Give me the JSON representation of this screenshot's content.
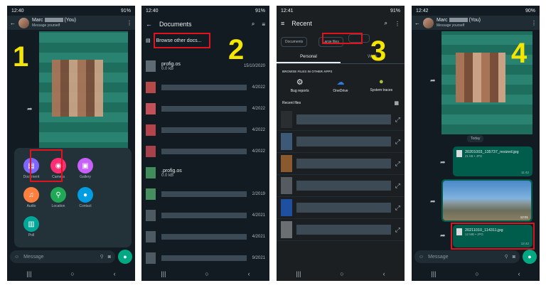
{
  "panel_numbers": [
    "1",
    "2",
    "3",
    "4"
  ],
  "phone1": {
    "time": "12:40",
    "battery": "91%",
    "contact": "Marc",
    "contact_suffix": "(You)",
    "subtitle": "Message yourself",
    "attach": [
      {
        "label": "Document",
        "color": "#7f66ff"
      },
      {
        "label": "Camera",
        "color": "#ff2e74"
      },
      {
        "label": "Gallery",
        "color": "#c861fa"
      },
      {
        "label": "Audio",
        "color": "#ff7f3e"
      },
      {
        "label": "Location",
        "color": "#1fa855"
      },
      {
        "label": "Contact",
        "color": "#009de2"
      },
      {
        "label": "Poll",
        "color": "#02a698"
      }
    ],
    "message_placeholder": "Message"
  },
  "phone2": {
    "time": "12:40",
    "battery": "91%",
    "title": "Documents",
    "browse": "Browse other docs...",
    "first_file": {
      "name": "profig.os",
      "size": "0.0 kB",
      "date": "15/10/2020"
    },
    "file2_name": ".profig.os",
    "file2_size": "0.0 kB",
    "dates": [
      "4/2022",
      "4/2022",
      "4/2022",
      "4/2022",
      "",
      "2/2019",
      "4/2021",
      "4/2021",
      "9/2021"
    ]
  },
  "phone3": {
    "time": "12:41",
    "battery": "91%",
    "title": "Recent",
    "chips": [
      "Documents",
      "Large files"
    ],
    "tabs": [
      "Personal",
      "Work"
    ],
    "section": "BROWSE FILES IN OTHER APPS",
    "apps": [
      "Bug reports",
      "OneDrive",
      "System traces"
    ],
    "recent": "Recent files"
  },
  "phone4": {
    "time": "12:42",
    "battery": "90%",
    "contact": "Marc",
    "contact_suffix": "(You)",
    "subtitle": "Message yourself",
    "today": "Today",
    "file1": {
      "name": "20201003_135737_resized.jpg",
      "meta": "21 kB • JPG",
      "time": "11:42"
    },
    "photo_time": "12:01",
    "file2": {
      "name": "20211010_114311.jpg",
      "meta": "12 MB • JPG",
      "time": "12:42"
    },
    "message_placeholder": "Message"
  }
}
